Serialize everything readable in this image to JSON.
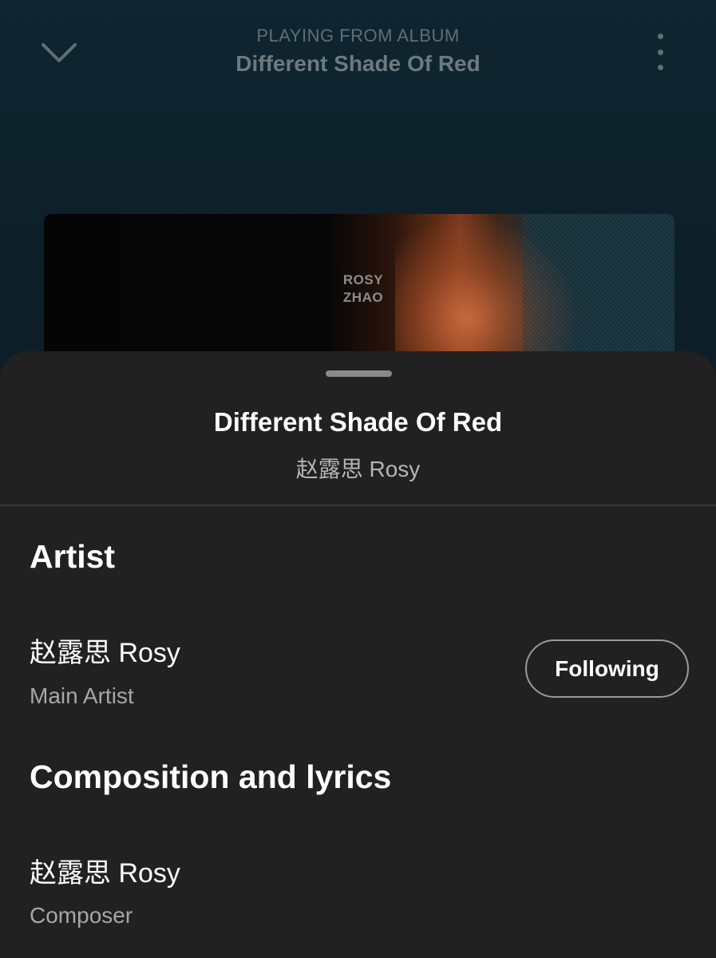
{
  "header": {
    "subtitle": "PLAYING FROM ALBUM",
    "title": "Different Shade Of Red",
    "collapse_icon": "chevron-down-icon",
    "more_icon": "more-vertical-icon"
  },
  "cover": {
    "text": "ROSY\nZHAO"
  },
  "sheet": {
    "title": "Different Shade Of Red",
    "artist": "赵露思 Rosy",
    "sections": [
      {
        "heading": "Artist",
        "credits": [
          {
            "name": "赵露思 Rosy",
            "role": "Main Artist",
            "button": "Following"
          }
        ]
      },
      {
        "heading": "Composition and lyrics",
        "credits": [
          {
            "name": "赵露思 Rosy",
            "role": "Composer"
          }
        ]
      }
    ]
  },
  "colors": {
    "sheet_background": "#212121",
    "player_background": "#0d1d24"
  }
}
